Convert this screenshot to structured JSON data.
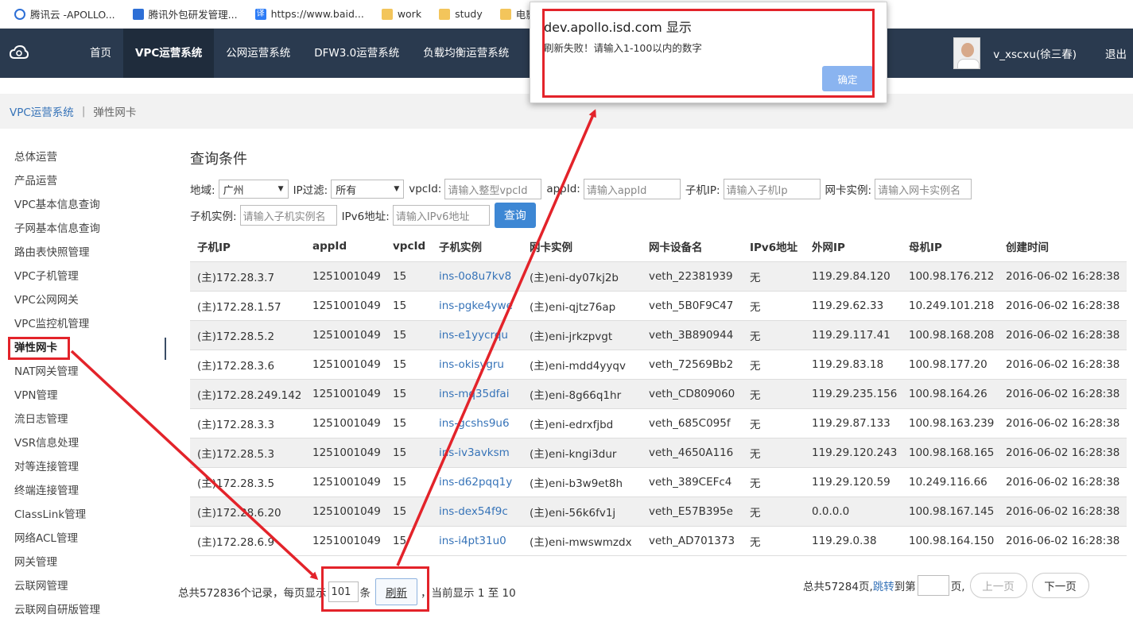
{
  "bookmarks": [
    {
      "label": "腾讯云 -APOLLO...",
      "icon": "cloud-icon"
    },
    {
      "label": "腾讯外包研发管理...",
      "icon": "tencent-icon"
    },
    {
      "label": "https://www.baid...",
      "icon": "translate-icon",
      "glyph": "译"
    },
    {
      "label": "work",
      "icon": "folder-icon"
    },
    {
      "label": "study",
      "icon": "folder-icon"
    },
    {
      "label": "电影下",
      "icon": "folder-icon"
    }
  ],
  "topnav": {
    "items": [
      "首页",
      "VPC运营系统",
      "公网运营系统",
      "DFW3.0运营系统",
      "负载均衡运营系统"
    ],
    "active_index": 1,
    "username": "v_xscxu(徐三春)",
    "logout": "退出"
  },
  "breadcrumb": {
    "root": "VPC运营系统",
    "sep": "|",
    "current": "弹性网卡"
  },
  "sidebar": {
    "items": [
      "总体运营",
      "产品运营",
      "VPC基本信息查询",
      "子网基本信息查询",
      "路由表快照管理",
      "VPC子机管理",
      "VPC公网网关",
      "VPC监控机管理",
      "弹性网卡",
      "NAT网关管理",
      "VPN管理",
      "流日志管理",
      "VSR信息处理",
      "对等连接管理",
      "终端连接管理",
      "ClassLink管理",
      "网络ACL管理",
      "网关管理",
      "云联网管理",
      "云联网自研版管理"
    ],
    "active_index": 8
  },
  "query": {
    "title": "查询条件",
    "region_label": "地域:",
    "region_value": "广州",
    "ipfilter_label": "IP过滤:",
    "ipfilter_value": "所有",
    "vpcid_label": "vpcId:",
    "vpcid_placeholder": "请输入整型vpcId",
    "appid_label": "appId:",
    "appid_placeholder": "请输入appId",
    "subip_label": "子机IP:",
    "subip_placeholder": "请输入子机Ip",
    "eni_label": "网卡实例:",
    "eni_placeholder": "请输入网卡实例名",
    "subins_label": "子机实例:",
    "subins_placeholder": "请输入子机实例名",
    "ipv6_label": "IPv6地址:",
    "ipv6_placeholder": "请输入IPv6地址",
    "search_button": "查询"
  },
  "table": {
    "headers": [
      "子机IP",
      "appId",
      "vpcId",
      "子机实例",
      "网卡实例",
      "网卡设备名",
      "IPv6地址",
      "外网IP",
      "母机IP",
      "创建时间"
    ],
    "rows": [
      [
        "(主)172.28.3.7",
        "1251001049",
        "15",
        "ins-0o8u7kv8",
        "(主)eni-dy07kj2b",
        "veth_22381939",
        "无",
        "119.29.84.120",
        "100.98.176.212",
        "2016-06-02 16:28:38"
      ],
      [
        "(主)172.28.1.57",
        "1251001049",
        "15",
        "ins-pgke4ywe",
        "(主)eni-qjtz76ap",
        "veth_5B0F9C47",
        "无",
        "119.29.62.33",
        "10.249.101.218",
        "2016-06-02 16:28:38"
      ],
      [
        "(主)172.28.5.2",
        "1251001049",
        "15",
        "ins-e1yycrqu",
        "(主)eni-jrkzpvgt",
        "veth_3B890944",
        "无",
        "119.29.117.41",
        "100.98.168.208",
        "2016-06-02 16:28:38"
      ],
      [
        "(主)172.28.3.6",
        "1251001049",
        "15",
        "ins-okisygru",
        "(主)eni-mdd4yyqv",
        "veth_72569Bb2",
        "无",
        "119.29.83.18",
        "100.98.177.20",
        "2016-06-02 16:28:38"
      ],
      [
        "(主)172.28.249.142",
        "1251001049",
        "15",
        "ins-mq35dfai",
        "(主)eni-8g66q1hr",
        "veth_CD809060",
        "无",
        "119.29.235.156",
        "100.98.164.26",
        "2016-06-02 16:28:38"
      ],
      [
        "(主)172.28.3.3",
        "1251001049",
        "15",
        "ins-gcshs9u6",
        "(主)eni-edrxfjbd",
        "veth_685C095f",
        "无",
        "119.29.87.133",
        "100.98.163.239",
        "2016-06-02 16:28:38"
      ],
      [
        "(主)172.28.5.3",
        "1251001049",
        "15",
        "ins-iv3avksm",
        "(主)eni-kngi3dur",
        "veth_4650A116",
        "无",
        "119.29.120.243",
        "100.98.168.165",
        "2016-06-02 16:28:38"
      ],
      [
        "(主)172.28.3.5",
        "1251001049",
        "15",
        "ins-d62pqq1y",
        "(主)eni-b3w9et8h",
        "veth_389CEFc4",
        "无",
        "119.29.120.59",
        "10.249.116.66",
        "2016-06-02 16:28:38"
      ],
      [
        "(主)172.28.6.20",
        "1251001049",
        "15",
        "ins-dex54f9c",
        "(主)eni-56k6fv1j",
        "veth_E57B395e",
        "无",
        "0.0.0.0",
        "100.98.167.145",
        "2016-06-02 16:28:38"
      ],
      [
        "(主)172.28.6.9",
        "1251001049",
        "15",
        "ins-i4pt31u0",
        "(主)eni-mwswmzdx",
        "veth_AD701373",
        "无",
        "119.29.0.38",
        "100.98.164.150",
        "2016-06-02 16:28:38"
      ]
    ]
  },
  "pager": {
    "total_prefix": "总共572836个记录，每页显示",
    "per_page_value": "101",
    "unit": "条",
    "refresh_button": "刷新",
    "current_display": "，当前显示 1 至 10",
    "total_pages": "总共57284页,",
    "jump_link": "跳转",
    "to_page": "到第",
    "page_suffix": "页,",
    "prev_button": "上一页",
    "next_button": "下一页"
  },
  "dialog": {
    "title": "dev.apollo.isd.com 显示",
    "message": "刷新失败！请输入1-100以内的数字",
    "ok_button": "确定"
  },
  "colors": {
    "nav_bg": "#2a3a4f",
    "annotation_red": "#e3232a",
    "link_blue": "#3673b8",
    "button_blue": "#3d87d4"
  }
}
